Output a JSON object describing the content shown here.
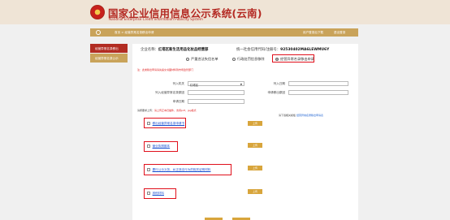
{
  "header": {
    "title": "国家企业信用信息公示系统(云南)",
    "subtitle": "National Enterprise Credit Information Publicity System"
  },
  "navbar": {
    "breadcrumb": "首页 > 经营异常名录移出申请",
    "login_label": "用户登录后下载",
    "user_label": "退出登录"
  },
  "sidebar": {
    "items": [
      {
        "label": "经营异常名录移出"
      },
      {
        "label": "经营异常名录公示"
      }
    ]
  },
  "enterprise": {
    "name_label": "企业名称：",
    "name": "红塔区新生活用品化妆品经营部",
    "code_label": "统一社会信用代码/注册号：",
    "code": "92530402MA6LEWMU6Y"
  },
  "reason_options": [
    {
      "label": "严重违法失信名单",
      "selected": false
    },
    {
      "label": "行政处罚信息移除",
      "selected": false
    },
    {
      "label": "经营异常名录移出申请",
      "selected": true
    }
  ],
  "note": "注：此类移出申请请先提交书面材料到市场监管部门",
  "form": {
    "authority_label": "列入机关",
    "authority_value": "红塔区",
    "date_label": "列入日期",
    "reason_label": "列入经营异常名录原因",
    "reason_value": "",
    "remove_reason_label": "申请移出原因",
    "remove_reason_value": "",
    "doc_no_label": "申请日期",
    "doc_no_value": ""
  },
  "upload": {
    "hint_prefix": "请按要求上传：",
    "hint_red": "请上传正本扫描件，支持pdf、jpg格式",
    "right_text": "请下载相关模板",
    "right_link": "经营异常名录移出申请表"
  },
  "documents": [
    {
      "label": "移出经营异常名录申请书",
      "button": "上传"
    },
    {
      "label": "营业执照副本",
      "button": "上传"
    },
    {
      "label": "履行公示义务、纠正违法行为的相关证明材料",
      "button": "上传"
    },
    {
      "label": "其他材料",
      "button": "上传"
    }
  ]
}
